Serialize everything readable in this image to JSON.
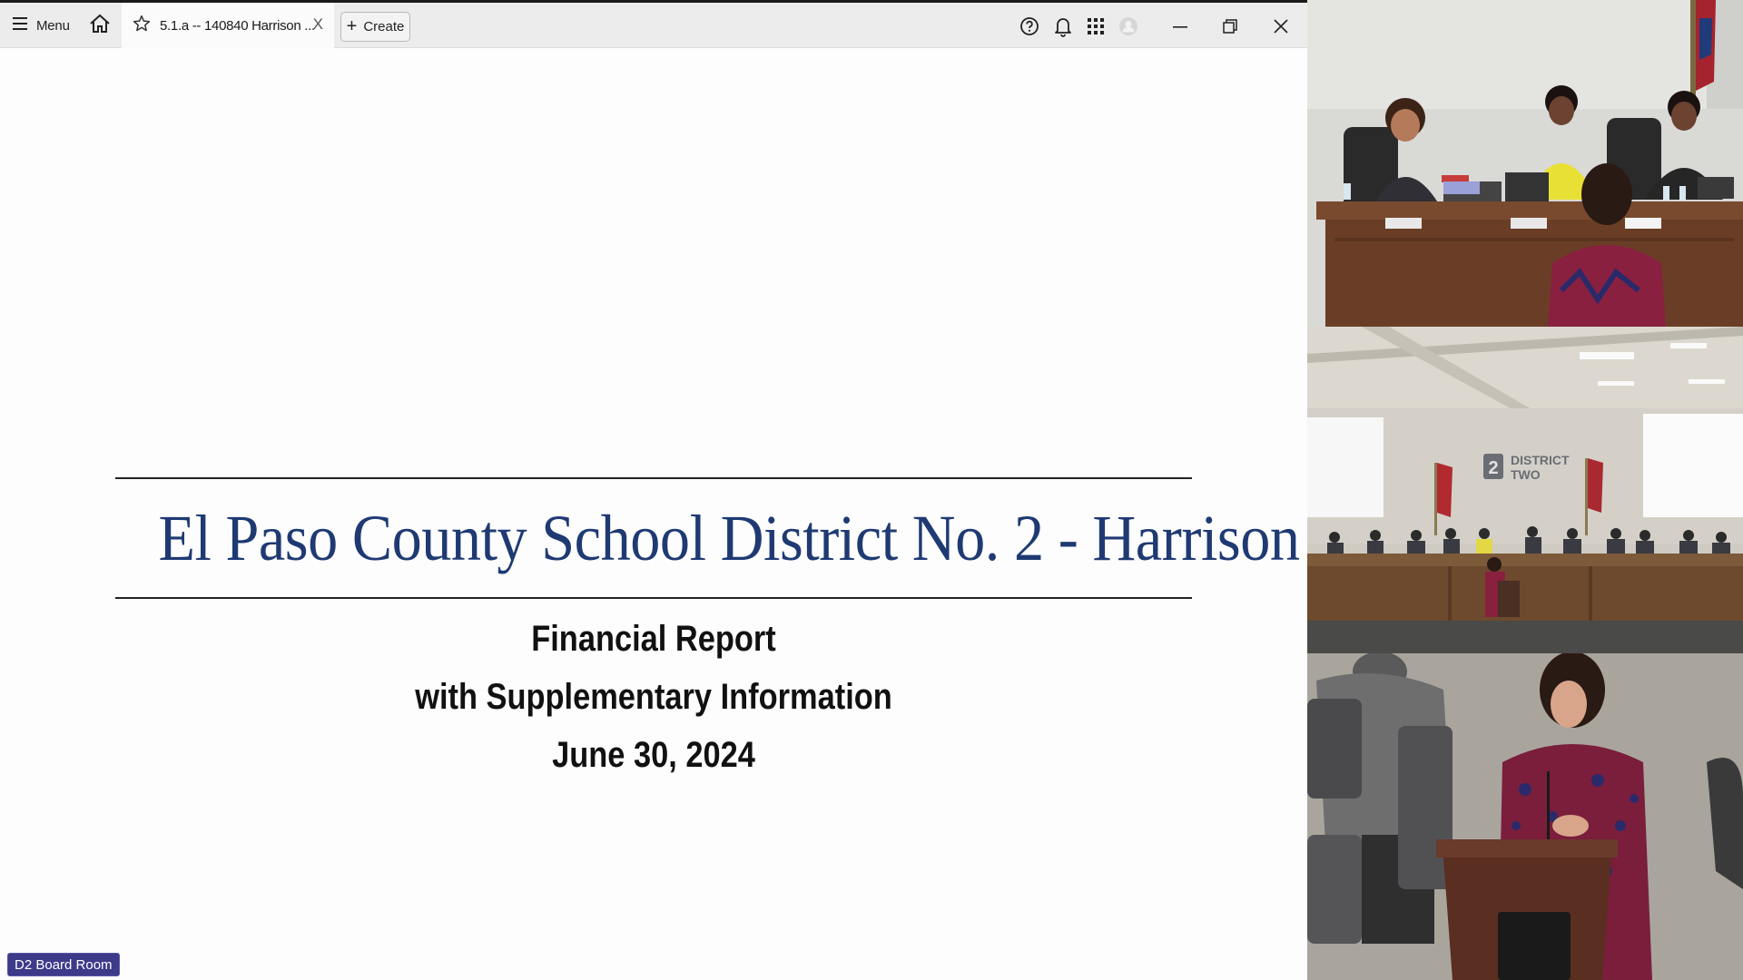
{
  "toolbar": {
    "menu_label": "Menu",
    "tab_title": "5.1.a -- 140840 Harrison ...",
    "tab_close": "X",
    "create_label": "Create",
    "icons": [
      "menu-icon",
      "home-icon",
      "star-icon",
      "close-icon",
      "plus-icon",
      "help-icon",
      "bell-icon",
      "apps-grid-icon",
      "avatar-icon",
      "minimize-icon",
      "restore-icon",
      "close-window-icon"
    ]
  },
  "document": {
    "title": "El Paso County School District No. 2 - Harrison",
    "line1": "Financial Report",
    "line2": "with Supplementary Information",
    "line3": "June 30, 2024"
  },
  "badge": {
    "label": "D2 Board Room"
  },
  "camera2": {
    "wall_logo_line1": "DISTRICT",
    "wall_logo_line2": "TWO",
    "wall_logo_number": "2"
  },
  "colors": {
    "title_blue": "#1f3a73",
    "badge_bg": "#3d3a8a",
    "toolbar_bg": "#ececec"
  }
}
